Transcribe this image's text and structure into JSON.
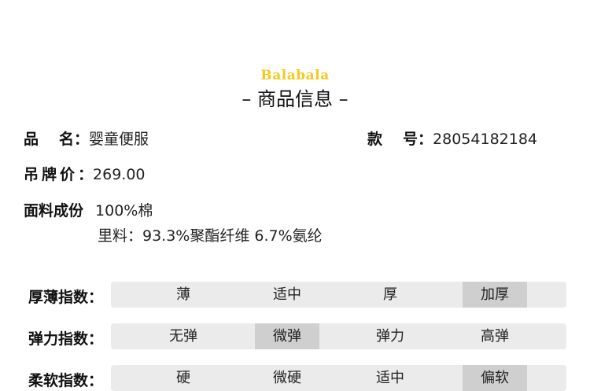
{
  "header": {
    "brand": "Balabala",
    "title": "– 商品信息 –"
  },
  "info": {
    "name_label": "品 名",
    "name_value": "婴童便服",
    "style_label": "款 号",
    "style_value": "28054182184",
    "price_label": "吊牌价",
    "price_value": "269.00",
    "fabric_label": "面料成份",
    "fabric_value": "100%棉",
    "lining_value": "里料：93.3%聚酯纤维 6.7%氨纶"
  },
  "indices": [
    {
      "label": "厚薄指数：",
      "options": [
        "薄",
        "适中",
        "厚",
        "加厚"
      ],
      "selected": "加厚"
    },
    {
      "label": "弹力指数：",
      "options": [
        "无弹",
        "微弹",
        "弹力",
        "高弹"
      ],
      "selected": "微弹"
    },
    {
      "label": "柔软指数：",
      "options": [
        "硬",
        "微硬",
        "适中",
        "偏软"
      ],
      "selected": "偏软"
    }
  ],
  "colors": {
    "brand": "#f3c91b",
    "bar": "#ebebeb",
    "selected": "#cfcfcf"
  }
}
